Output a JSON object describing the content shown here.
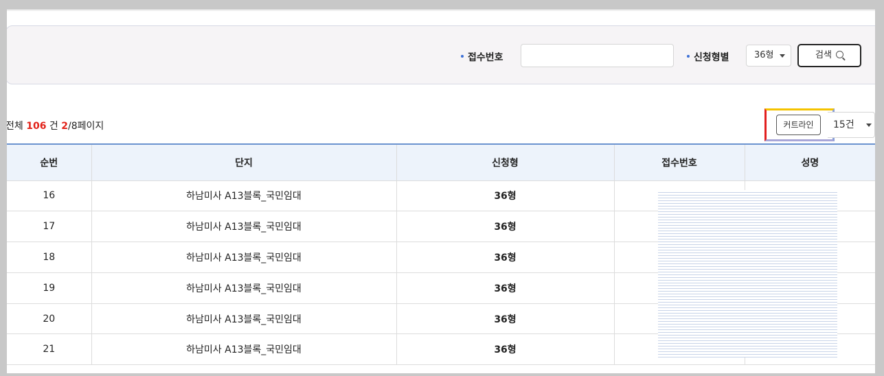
{
  "search": {
    "receipt_label": "접수번호",
    "receipt_value": "",
    "type_label": "신청형별",
    "type_selected": "36형",
    "search_button_label": "검색"
  },
  "summary": {
    "total_prefix": "전체 ",
    "total_count": "106",
    "total_suffix": " 건 ",
    "current_page": "2",
    "page_suffix": "/8페이지"
  },
  "toolbar": {
    "curtain_label": "커트라인",
    "page_size_selected": "15건"
  },
  "table": {
    "headers": [
      "순번",
      "단지",
      "신청형",
      "접수번호",
      "성명"
    ],
    "rows": [
      {
        "no": "16",
        "complex": "하남미사 A13블록_국민임대",
        "type": "36형",
        "receipt": "",
        "name": ""
      },
      {
        "no": "17",
        "complex": "하남미사 A13블록_국민임대",
        "type": "36형",
        "receipt": "",
        "name": ""
      },
      {
        "no": "18",
        "complex": "하남미사 A13블록_국민임대",
        "type": "36형",
        "receipt": "",
        "name": ""
      },
      {
        "no": "19",
        "complex": "하남미사 A13블록_국민임대",
        "type": "36형",
        "receipt": "",
        "name": ""
      },
      {
        "no": "20",
        "complex": "하남미사 A13블록_국민임대",
        "type": "36형",
        "receipt": "",
        "name": ""
      },
      {
        "no": "21",
        "complex": "하남미사 A13블록_국민임대",
        "type": "36형",
        "receipt": "",
        "name": ""
      }
    ]
  },
  "colors": {
    "accent_red": "#e2231a",
    "header_blue": "#6a92cf",
    "highlight_yellow": "#f5c300"
  }
}
